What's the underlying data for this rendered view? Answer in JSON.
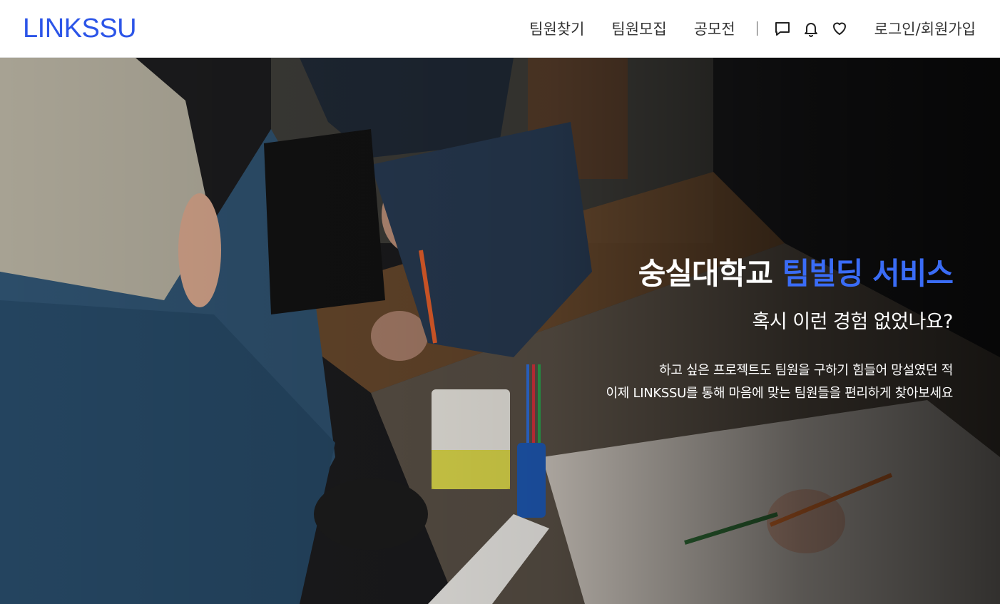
{
  "brand": {
    "logo": "LINKSSU",
    "accent_color": "#2c55e8"
  },
  "nav": {
    "links": [
      {
        "label": "팀원찾기"
      },
      {
        "label": "팀원모집"
      },
      {
        "label": "공모전"
      }
    ],
    "icons": [
      "chat-icon",
      "bell-icon",
      "heart-icon"
    ],
    "auth_label": "로그인/회원가입"
  },
  "hero": {
    "title_main": "숭실대학교 ",
    "title_accent": "팀빌딩 서비스",
    "subtitle": "혹시 이런 경험 없었나요?",
    "desc_line1": "하고 싶은 프로젝트도 팀원을 구하기 힘들어 망설였던 적",
    "desc_line2": "이제 LINKSSU를 통해 마음에 맞는 팀원들을 편리하게 찾아보세요",
    "accent_color": "#3a6cf6"
  }
}
